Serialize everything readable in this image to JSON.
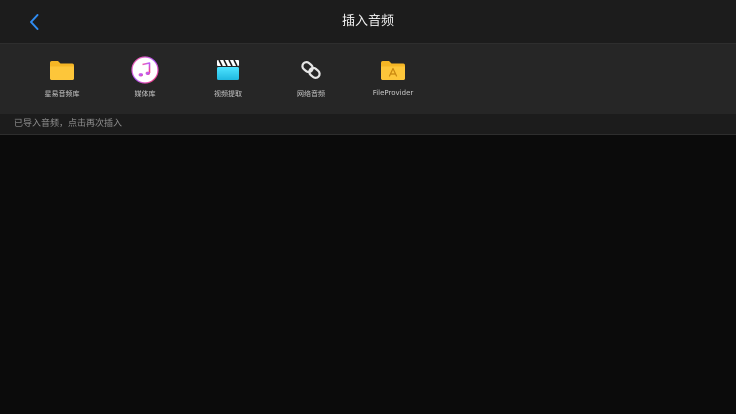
{
  "navbar": {
    "back_icon": "chevron-left-icon",
    "title": "插入音频",
    "accent_color": "#2f8cf2"
  },
  "sources": [
    {
      "label": "星易音频库",
      "icon": "folder-icon"
    },
    {
      "label": "媒体库",
      "icon": "music-icon"
    },
    {
      "label": "视频提取",
      "icon": "clapperboard-icon"
    },
    {
      "label": "网络音频",
      "icon": "link-icon"
    },
    {
      "label": "FileProvider",
      "icon": "folder-app-icon"
    }
  ],
  "hint": {
    "text": "已导入音频，点击再次插入"
  }
}
